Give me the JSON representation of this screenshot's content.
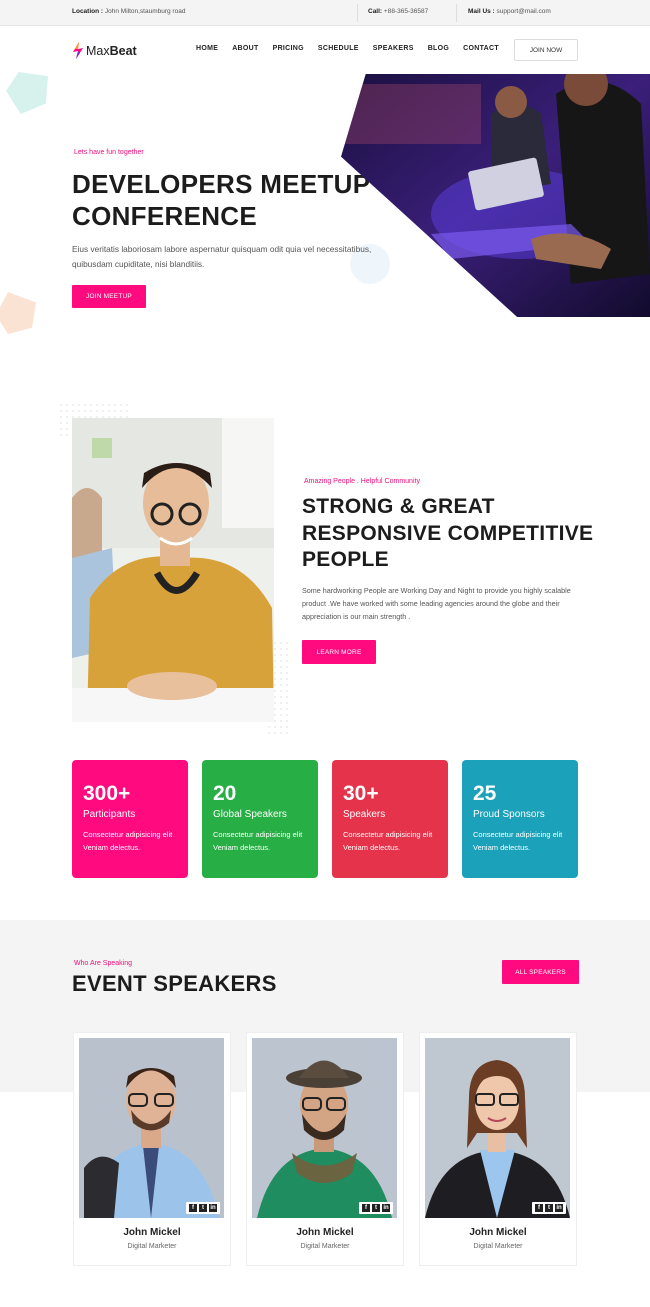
{
  "topbar": {
    "location_label": "Location :",
    "location_value": "John Milton,staumburg road",
    "call_label": "Call:",
    "call_value": "+88-365-36587",
    "mail_label": "Mail Us :",
    "mail_value": "support@mail.com"
  },
  "header": {
    "logo_light": "Max",
    "logo_bold": "Beat",
    "nav": [
      "HOME",
      "ABOUT",
      "PRICING",
      "SCHEDULE",
      "SPEAKERS",
      "BLOG",
      "CONTACT"
    ],
    "join_now": "JOIN NOW"
  },
  "hero": {
    "kicker": "Lets have fun together",
    "title": "DEVELOPERS MEETUP CONFERENCE",
    "description": "Eius veritatis laboriosam labore aspernatur quisquam odit quia vel necessitatibus, quibusdam cupiditate, nisi blanditiis.",
    "cta": "JOIN MEETUP"
  },
  "about": {
    "kicker": "Amazing People . Helpful Community",
    "title": "STRONG & GREAT RESPONSIVE COMPETITIVE PEOPLE",
    "description": "Some hardworking People are Working Day and Night to provide you highly scalable product .We have worked with some leading agencies around the globe and their appreciation is our main strength .",
    "cta": "LEARN MORE"
  },
  "stats": [
    {
      "number": "300+",
      "label": "Participants",
      "text": "Consectetur adipisicing elit Veniam delectus.",
      "color": "#ff0b7f"
    },
    {
      "number": "20",
      "label": "Global Speakers",
      "text": "Consectetur adipisicing elit Veniam delectus.",
      "color": "#27ae45"
    },
    {
      "number": "30+",
      "label": "Speakers",
      "text": "Consectetur adipisicing elit Veniam delectus.",
      "color": "#e4334a"
    },
    {
      "number": "25",
      "label": "Proud Sponsors",
      "text": "Consectetur adipisicing elit Veniam delectus.",
      "color": "#1ba2ba"
    }
  ],
  "speakers": {
    "kicker": "Who Are Speaking",
    "title": "EVENT SPEAKERS",
    "all_button": "ALL SPEAKERS",
    "items": [
      {
        "name": "John Mickel",
        "role": "Digital Marketer"
      },
      {
        "name": "John Mickel",
        "role": "Digital Marketer"
      },
      {
        "name": "John Mickel",
        "role": "Digital Marketer"
      }
    ],
    "social_icons": [
      "facebook-icon",
      "twitter-icon",
      "linkedin-icon"
    ]
  },
  "colors": {
    "accent": "#ff0b7f",
    "green": "#27ae45",
    "red": "#e4334a",
    "teal": "#1ba2ba"
  }
}
